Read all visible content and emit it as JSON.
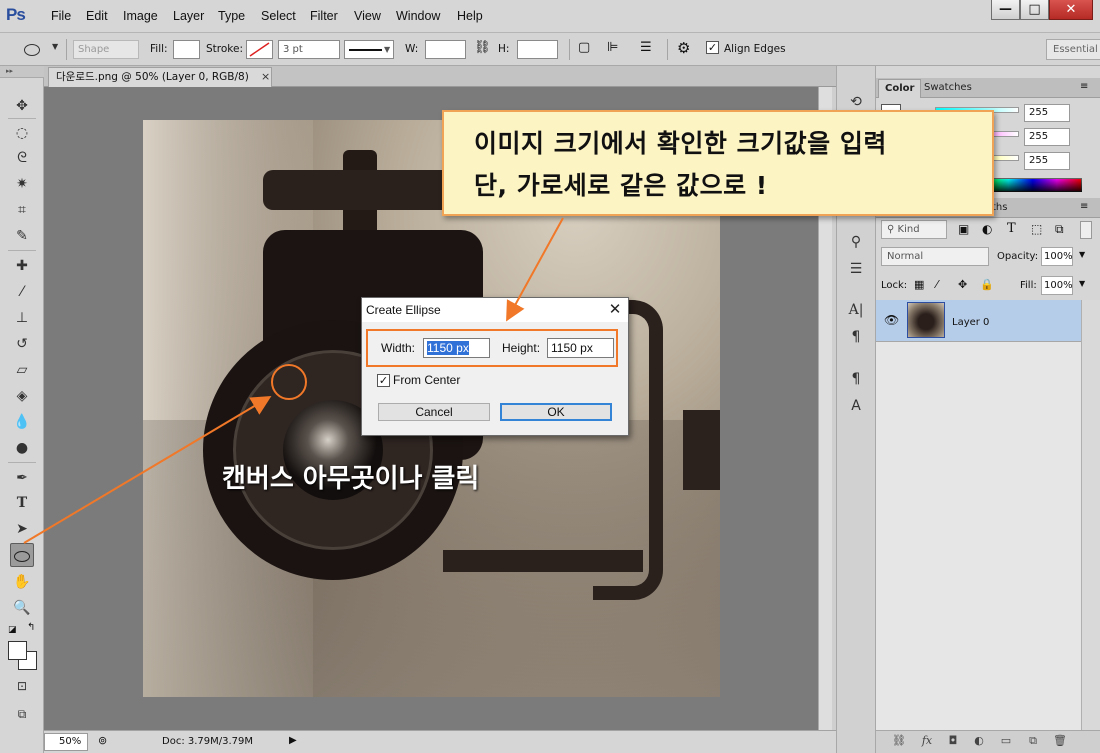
{
  "app": {
    "logo": "Ps",
    "menu": [
      "File",
      "Edit",
      "Image",
      "Layer",
      "Type",
      "Select",
      "Filter",
      "View",
      "Window",
      "Help"
    ],
    "window_buttons": {
      "minimize": "—",
      "maximize": "□",
      "close": "✕"
    }
  },
  "options_bar": {
    "mode": "Shape",
    "fill_label": "Fill:",
    "stroke_label": "Stroke:",
    "stroke_width": "3 pt",
    "w_label": "W:",
    "h_label": "H:",
    "align_edges_label": "Align Edges",
    "align_edges_checked": true,
    "workspace": "Essential"
  },
  "document": {
    "tab_title": "다운로드.png @ 50% (Layer 0, RGB/8)",
    "tab_close": "×",
    "zoom": "50%",
    "doc_info": "Doc: 3.79M/3.79M",
    "status_arrow": "▶"
  },
  "annotations": {
    "callout_line1": "이미지 크기에서 확인한 크기값을 입력",
    "callout_line2": "단, 가로세로 같은 값으로 !",
    "canvas_hint": "캔버스 아무곳이나 클릭",
    "accent_color": "#f07828"
  },
  "dialog": {
    "title": "Create Ellipse",
    "close": "✕",
    "width_label": "Width:",
    "width_value": "1150 px",
    "height_label": "Height:",
    "height_value": "1150 px",
    "from_center_label": "From Center",
    "from_center_checked": true,
    "cancel_label": "Cancel",
    "ok_label": "OK"
  },
  "color_panel": {
    "tabs": [
      "Color",
      "Swatches"
    ],
    "values": [
      "255",
      "255",
      "255"
    ]
  },
  "layers_panel": {
    "tab_fragment": "ths",
    "filter_kind": "Kind",
    "blend_mode": "Normal",
    "opacity_label": "Opacity:",
    "opacity_value": "100%",
    "lock_label": "Lock:",
    "fill_label": "Fill:",
    "fill_value": "100%",
    "layer_name": "Layer 0",
    "bottom_icons": [
      "link-icon",
      "fx-icon",
      "mask-icon",
      "adjustment-icon",
      "group-folder-icon",
      "new-layer-icon",
      "trash-icon"
    ]
  },
  "toolbox": {
    "tools": [
      "move-tool",
      "ellipse-marquee-tool",
      "lasso-tool",
      "quick-selection-tool",
      "crop-tool",
      "eyedropper-tool",
      "spot-healing-tool",
      "brush-tool",
      "clone-stamp-tool",
      "history-brush-tool",
      "eraser-tool",
      "paint-bucket-tool",
      "blur-tool",
      "dodge-tool",
      "pen-tool",
      "type-tool",
      "path-selection-tool",
      "ellipse-tool",
      "hand-tool",
      "zoom-tool"
    ],
    "active_tool": "ellipse-tool"
  }
}
